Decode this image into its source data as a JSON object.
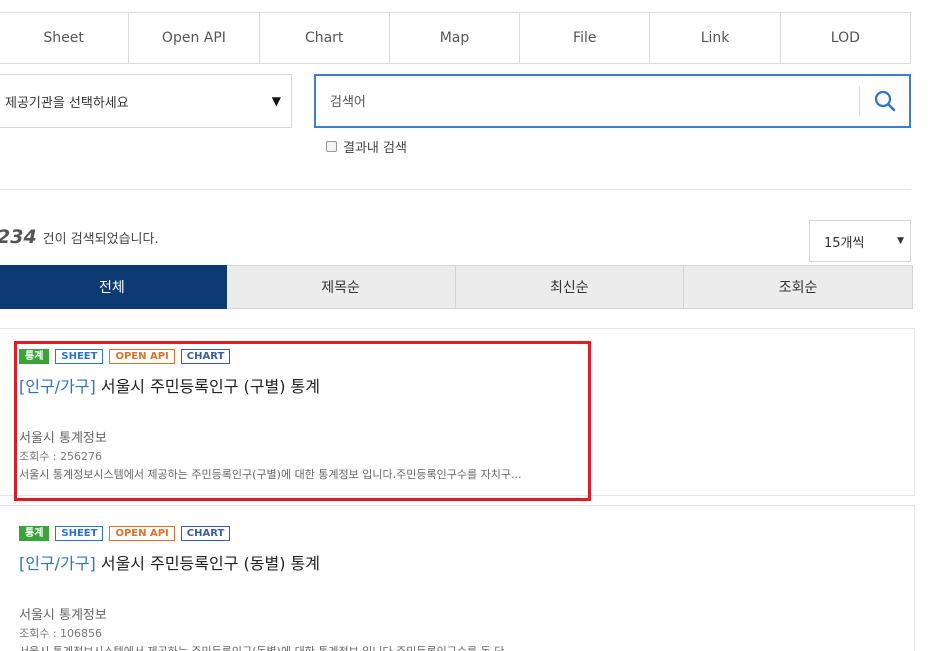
{
  "format_tabs": [
    "Sheet",
    "Open API",
    "Chart",
    "Map",
    "File",
    "Link",
    "LOD"
  ],
  "org_select": {
    "value": "제공기관을 선택하세요"
  },
  "search": {
    "placeholder": "검색어"
  },
  "refine_label": "결과내 검색",
  "result": {
    "count": "234",
    "count_text": "건이 검색되었습니다."
  },
  "per_page": {
    "value": "15개씩"
  },
  "sort_tabs": [
    "전체",
    "제목순",
    "최신순",
    "조회순"
  ],
  "results": [
    {
      "badges": [
        "통계",
        "SHEET",
        "OPEN API",
        "CHART"
      ],
      "category": "[인구/가구]",
      "title": "서울시 주민등록인구 (구별) 통계",
      "org": "서울시 통계정보",
      "views": "조회수 : 256276",
      "desc": "서울시 통계정보시스템에서 제공하는 주민등록인구(구별)에 대한 통계정보 입니다.주민등록인구수를 자치구..."
    },
    {
      "badges": [
        "통계",
        "SHEET",
        "OPEN API",
        "CHART"
      ],
      "category": "[인구/가구]",
      "title": "서울시 주민등록인구 (동별) 통계",
      "org": "서울시 통계정보",
      "views": "조회수 : 106856",
      "desc": "서울시 통계정보시스템에서 제공하는 주민등록인구(동별)에 대한 통계정보 입니다.주민등록인구수를 동 단..."
    }
  ],
  "colors": {
    "accent": "#3a7fd5",
    "active_tab": "#0d3a72",
    "highlight": "#e01b24"
  },
  "icons": {
    "search": "search-icon",
    "dropdown": "caret-down-icon"
  }
}
